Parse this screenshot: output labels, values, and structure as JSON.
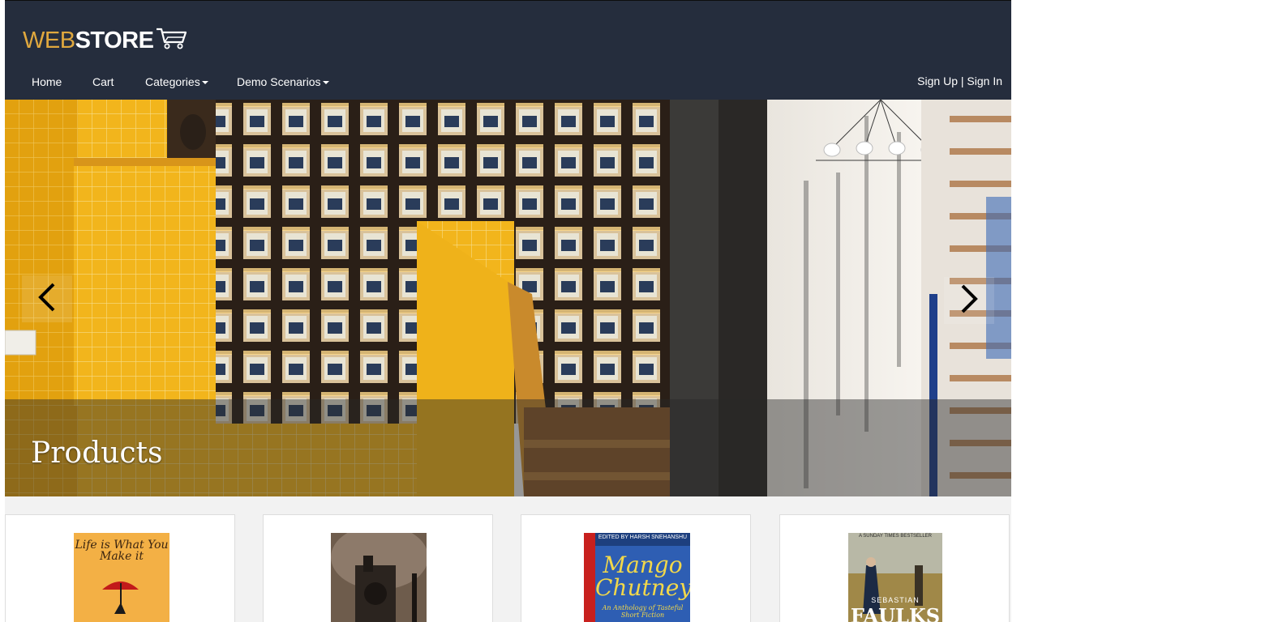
{
  "brand": {
    "logo_web": "WEB",
    "logo_store": "STORE",
    "logo_icon": "shopping-cart-icon"
  },
  "nav": {
    "items": [
      {
        "label": "Home"
      },
      {
        "label": "Cart"
      },
      {
        "label": "Categories"
      },
      {
        "label": "Demo Scenarios"
      }
    ],
    "auth": {
      "signup": "Sign Up",
      "separator": "|",
      "signin": "Sign In"
    }
  },
  "carousel": {
    "caption": "Products",
    "prev_icon": "chevron-left-icon",
    "next_icon": "chevron-right-icon"
  },
  "products": [
    {
      "cover_title": "Life is What You Make it",
      "cover_color": "#f0a032"
    },
    {
      "cover_title": "",
      "cover_color": "#5a4a3e"
    },
    {
      "cover_title": "Mango Chutney",
      "cover_subtitle": "An Anthology of Tasteful Short Fiction",
      "cover_editor": "EDITED BY HARSH SNEHANSHU",
      "cover_color": "#2f5fb0"
    },
    {
      "cover_title": "FAULKS",
      "cover_author": "SEBASTIAN",
      "cover_badge": "A SUNDAY TIMES BESTSELLER",
      "cover_color": "#8a8a6a"
    }
  ],
  "colors": {
    "navbar": "#252d3d",
    "logo_accent": "#e0a83e",
    "page_bg": "#f2f2f2"
  }
}
